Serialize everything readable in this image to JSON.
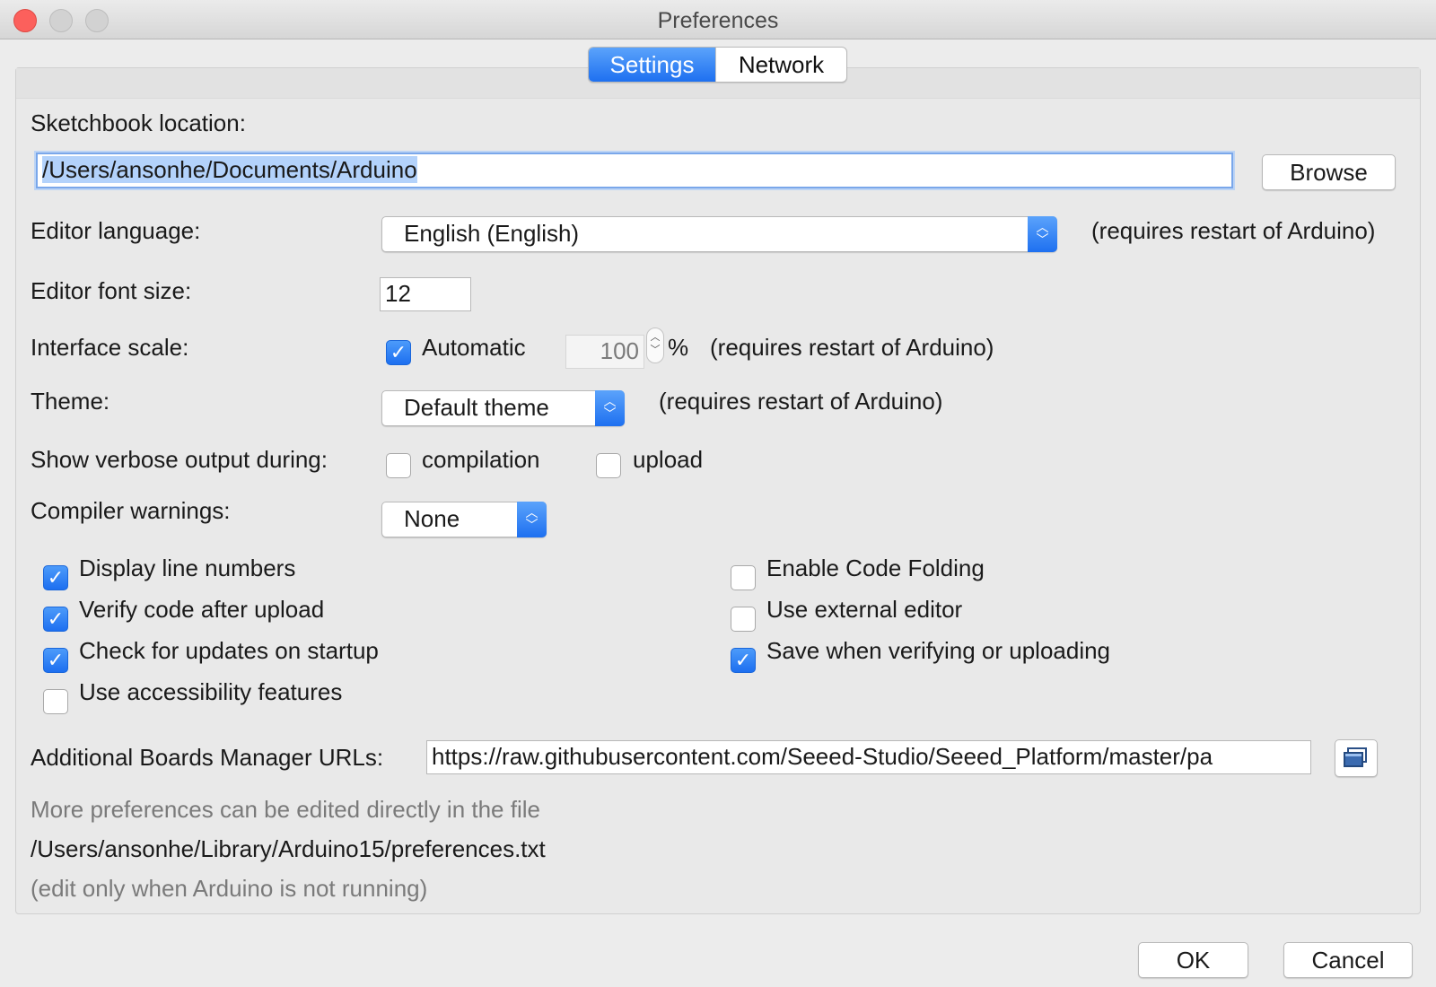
{
  "window": {
    "title": "Preferences"
  },
  "tabs": [
    {
      "label": "Settings",
      "active": true
    },
    {
      "label": "Network",
      "active": false
    }
  ],
  "sketchbook": {
    "label": "Sketchbook location:",
    "value": "/Users/ansonhe/Documents/Arduino",
    "browse_label": "Browse"
  },
  "editor_language": {
    "label": "Editor language:",
    "value": "English (English)",
    "note": "(requires restart of Arduino)"
  },
  "font_size": {
    "label": "Editor font size:",
    "value": "12"
  },
  "interface_scale": {
    "label": "Interface scale:",
    "auto_label": "Automatic",
    "auto_checked": true,
    "value": "100",
    "unit": "%",
    "note": "(requires restart of Arduino)"
  },
  "theme": {
    "label": "Theme:",
    "value": "Default theme",
    "note": "(requires restart of Arduino)"
  },
  "verbose": {
    "label": "Show verbose output during:",
    "compilation_label": "compilation",
    "compilation_checked": false,
    "upload_label": "upload",
    "upload_checked": false
  },
  "compiler_warnings": {
    "label": "Compiler warnings:",
    "value": "None"
  },
  "options_left": [
    {
      "label": "Display line numbers",
      "checked": true
    },
    {
      "label": "Verify code after upload",
      "checked": true
    },
    {
      "label": "Check for updates on startup",
      "checked": true
    },
    {
      "label": "Use accessibility features",
      "checked": false
    }
  ],
  "options_right": [
    {
      "label": "Enable Code Folding",
      "checked": false
    },
    {
      "label": "Use external editor",
      "checked": false
    },
    {
      "label": "Save when verifying or uploading",
      "checked": true
    }
  ],
  "boards_urls": {
    "label": "Additional Boards Manager URLs:",
    "value": "https://raw.githubusercontent.com/Seeed-Studio/Seeed_Platform/master/pa"
  },
  "footer": {
    "line1": "More preferences can be edited directly in the file",
    "line2": "/Users/ansonhe/Library/Arduino15/preferences.txt",
    "line3": "(edit only when Arduino is not running)"
  },
  "buttons": {
    "ok": "OK",
    "cancel": "Cancel"
  },
  "colors": {
    "accent": "#1e70f0",
    "close": "#fc605c",
    "background": "#ececec"
  },
  "icons": {
    "check": "✓",
    "select_arrows": "⌃⌄",
    "copy": "window-stack-icon"
  }
}
